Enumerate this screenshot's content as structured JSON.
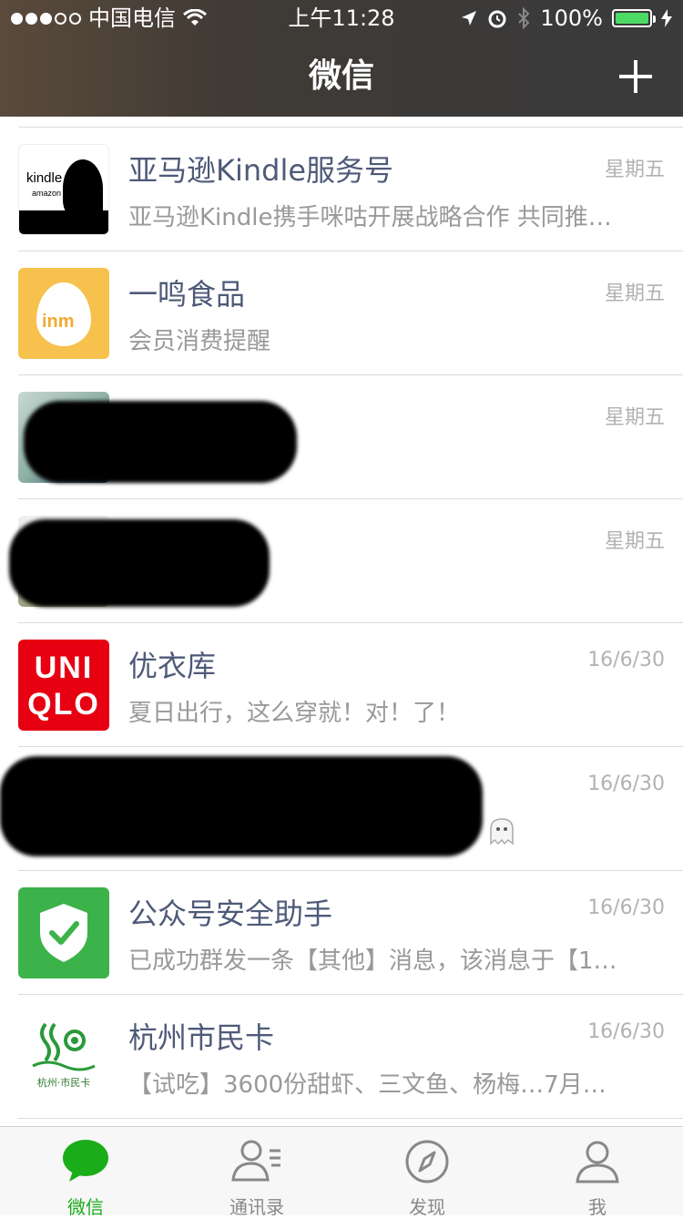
{
  "status_bar": {
    "carrier": "中国电信",
    "time": "上午11:28",
    "battery": "100%"
  },
  "header": {
    "title": "微信"
  },
  "chats": [
    {
      "name": "亚马逊Kindle服务号",
      "preview": "亚马逊Kindle携手咪咕开展战略合作 共同推…",
      "time": "星期五",
      "avatar_text_1": "kindle",
      "avatar_text_2": "amazon"
    },
    {
      "name": "一鸣食品",
      "preview": "会员消费提醒",
      "time": "星期五",
      "avatar_text_1": "inm"
    },
    {
      "name": "",
      "preview": "",
      "time": "星期五"
    },
    {
      "name": "",
      "preview": "",
      "time": "星期五"
    },
    {
      "name": "优衣库",
      "preview": "夏日出行，这么穿就！对！了！",
      "time": "16/6/30",
      "avatar_text_1": "UNI",
      "avatar_text_2": "QLO"
    },
    {
      "name": "",
      "preview": "",
      "time": "16/6/30"
    },
    {
      "name": "公众号安全助手",
      "preview": "已成功群发一条【其他】消息，该消息于【1…",
      "time": "16/6/30"
    },
    {
      "name": "杭州市民卡",
      "preview": "【试吃】3600份甜虾、三文鱼、杨梅…7月…",
      "time": "16/6/30",
      "avatar_text_1": "杭州·市民卡"
    }
  ],
  "tabs": [
    {
      "label": "微信",
      "active": true,
      "icon": "chat-bubble-icon"
    },
    {
      "label": "通讯录",
      "active": false,
      "icon": "contacts-icon"
    },
    {
      "label": "发现",
      "active": false,
      "icon": "compass-icon"
    },
    {
      "label": "我",
      "active": false,
      "icon": "person-icon"
    }
  ],
  "colors": {
    "accent_green": "#1aad19",
    "name_blue": "#4e5a78"
  }
}
